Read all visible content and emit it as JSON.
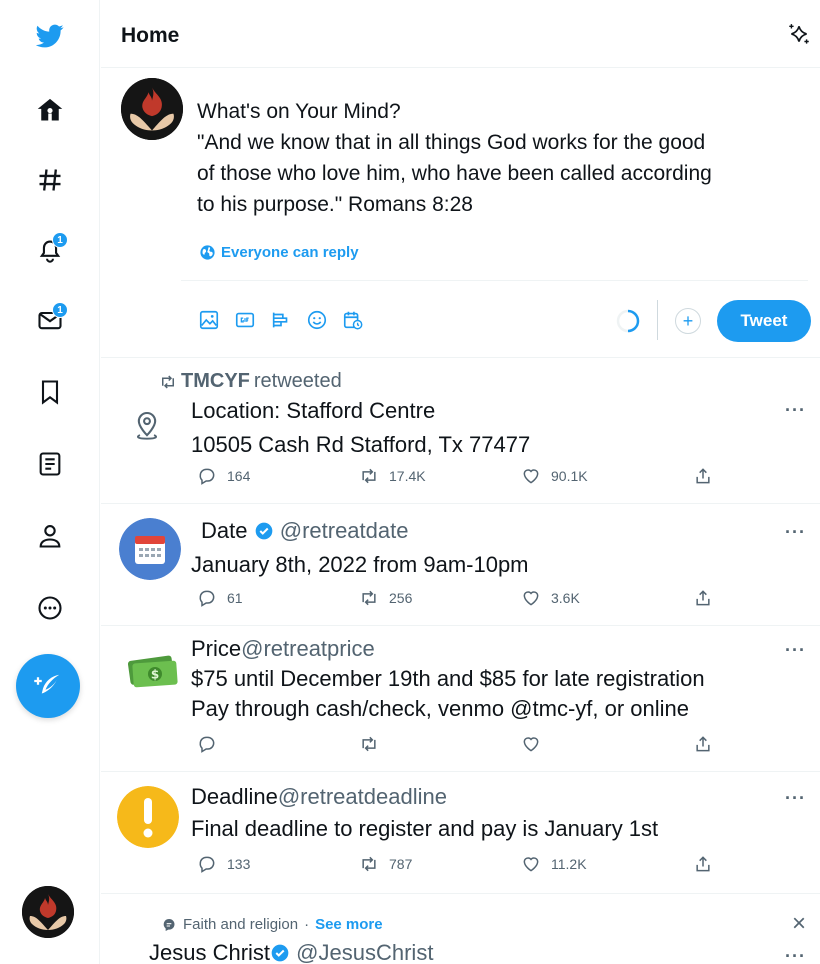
{
  "colors": {
    "accent": "#1d9bf0",
    "text": "#0f1419",
    "muted": "#536471",
    "border": "#eff3f4"
  },
  "rail": {
    "logo_icon": "twitter-bird-icon",
    "items": [
      {
        "name": "home-icon"
      },
      {
        "name": "explore-hashtag-icon"
      },
      {
        "name": "notifications-bell-icon",
        "badge": "1"
      },
      {
        "name": "messages-envelope-icon",
        "badge": "1"
      },
      {
        "name": "bookmarks-icon"
      },
      {
        "name": "lists-icon"
      },
      {
        "name": "profile-icon"
      },
      {
        "name": "more-circle-icon"
      }
    ],
    "compose_icon": "feather-plus-icon"
  },
  "header": {
    "title": "Home",
    "icon": "sparkle-icon"
  },
  "composer": {
    "text_lines": [
      "What's on Your Mind?",
      "\"And we know that in all things God works for the good",
      "of those who love him, who have been called according",
      "to his purpose.\" Romans 8:28"
    ],
    "reply_setting": "Everyone can reply",
    "tweet_button": "Tweet",
    "tools": [
      "image-icon",
      "gif-icon",
      "poll-icon",
      "emoji-icon",
      "schedule-icon"
    ]
  },
  "tweets": [
    {
      "retweeted_by": "TMCYF",
      "retweeted_label": "retweeted",
      "lines": [
        "Location: Stafford Centre",
        "10505 Cash Rd Stafford, Tx 77477"
      ],
      "replies": "164",
      "retweets": "17.4K",
      "likes": "90.1K"
    },
    {
      "name": "Date",
      "handle": "@retreatdate",
      "lines": [
        "January 8th, 2022 from 9am-10pm"
      ],
      "replies": "61",
      "retweets": "256",
      "likes": "3.6K"
    },
    {
      "name": "Price",
      "handle": "@retreatprice",
      "lines": [
        "$75 until December 19th and $85 for late registration",
        "Pay through cash/check, venmo @tmc-yf, or online"
      ],
      "replies": "",
      "retweets": "",
      "likes": ""
    },
    {
      "name": "Deadline",
      "handle": "@retreatdeadline",
      "lines": [
        "Final deadline to register and pay is January 1st"
      ],
      "replies": "133",
      "retweets": "787",
      "likes": "11.2K"
    }
  ],
  "topic": {
    "label": "Faith and religion",
    "separator": "·",
    "see_more": "See more"
  },
  "next_tweet": {
    "name": "Jesus Christ",
    "handle": "@JesusChrist"
  },
  "more_glyph": "···",
  "close_glyph": "×"
}
